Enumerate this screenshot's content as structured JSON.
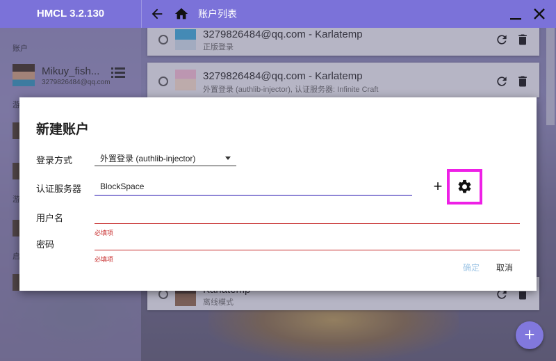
{
  "app": {
    "title": "HMCL 3.2.130",
    "page_title": "账户列表"
  },
  "sidebar": {
    "section_account": "账户",
    "account": {
      "name": "Mikuy_fish...",
      "email": "3279826484@qq.com"
    },
    "section_game": "游",
    "section_download": "游",
    "section_launch": "启"
  },
  "accounts": [
    {
      "title": "3279826484@qq.com - Karlatemp",
      "subtitle": "正版登录"
    },
    {
      "title": "3279826484@qq.com - Karlatemp",
      "subtitle": "外置登录 (authlib-injector), 认证服务器: Infinite Craft"
    },
    {
      "title": "Karlatemp",
      "subtitle": "离线模式"
    }
  ],
  "dialog": {
    "title": "新建账户",
    "login_method_label": "登录方式",
    "login_method_value": "外置登录 (authlib-injector)",
    "server_label": "认证服务器",
    "server_value": "BlockSpace",
    "add_symbol": "+",
    "username_label": "用户名",
    "password_label": "密码",
    "required_msg": "必填项",
    "confirm": "确定",
    "cancel": "取消"
  },
  "fab_symbol": "+",
  "colors": {
    "accent": "#7b72d9",
    "highlight": "#ee20e6",
    "error": "#c62828"
  }
}
